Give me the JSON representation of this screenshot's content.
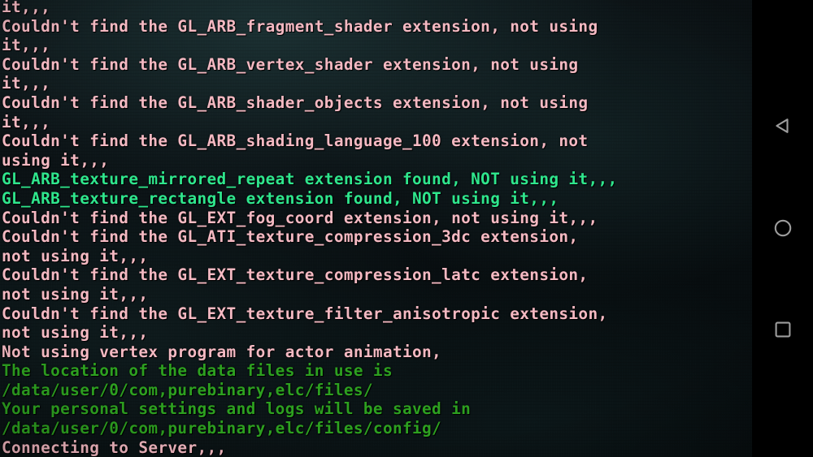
{
  "app": {
    "title": "Eternal Lands client console log",
    "background_color": "#0a1114",
    "nav_bar_color": "#000000"
  },
  "colors": {
    "text_pink": "#f4b9c2",
    "text_green_bright": "#2fe68d",
    "text_green_dark": "#2da020",
    "nav_icon": "#9d9d9d"
  },
  "console": {
    "lines": [
      {
        "text": "it,,,",
        "color": "pink"
      },
      {
        "text": "Couldn't find the GL_ARB_fragment_shader extension, not using",
        "color": "pink"
      },
      {
        "text": "it,,,",
        "color": "pink"
      },
      {
        "text": "Couldn't find the GL_ARB_vertex_shader extension, not using",
        "color": "pink"
      },
      {
        "text": "it,,,",
        "color": "pink"
      },
      {
        "text": "Couldn't find the GL_ARB_shader_objects extension, not using",
        "color": "pink"
      },
      {
        "text": "it,,,",
        "color": "pink"
      },
      {
        "text": "Couldn't find the GL_ARB_shading_language_100 extension, not",
        "color": "pink"
      },
      {
        "text": "using it,,,",
        "color": "pink"
      },
      {
        "text": "GL_ARB_texture_mirrored_repeat extension found, NOT using it,,,",
        "color": "green"
      },
      {
        "text": "GL_ARB_texture_rectangle extension found, NOT using it,,,",
        "color": "green"
      },
      {
        "text": "Couldn't find the GL_EXT_fog_coord extension, not using it,,,",
        "color": "pink"
      },
      {
        "text": "Couldn't find the GL_ATI_texture_compression_3dc extension,",
        "color": "pink"
      },
      {
        "text": "not using it,,,",
        "color": "pink"
      },
      {
        "text": "Couldn't find the GL_EXT_texture_compression_latc extension,",
        "color": "pink"
      },
      {
        "text": "not using it,,,",
        "color": "pink"
      },
      {
        "text": "Couldn't find the GL_EXT_texture_filter_anisotropic extension,",
        "color": "pink"
      },
      {
        "text": "not using it,,,",
        "color": "pink"
      },
      {
        "text": "Not using vertex program for actor animation,",
        "color": "pink"
      },
      {
        "text": "The location of the data files in use is",
        "color": "dgreen"
      },
      {
        "text": "/data/user/0/com,purebinary,elc/files/",
        "color": "dgreen"
      },
      {
        "text": "Your personal settings and logs will be saved in",
        "color": "dgreen"
      },
      {
        "text": "/data/user/0/com,purebinary,elc/files/config/",
        "color": "dgreen"
      },
      {
        "text": "Connecting to Server,,,",
        "color": "pink"
      }
    ]
  },
  "nav_bar": {
    "buttons": [
      {
        "name": "back",
        "label": "Back",
        "icon": "triangle-left-icon"
      },
      {
        "name": "home",
        "label": "Home",
        "icon": "circle-icon"
      },
      {
        "name": "recents",
        "label": "Recent apps",
        "icon": "square-icon"
      }
    ]
  }
}
